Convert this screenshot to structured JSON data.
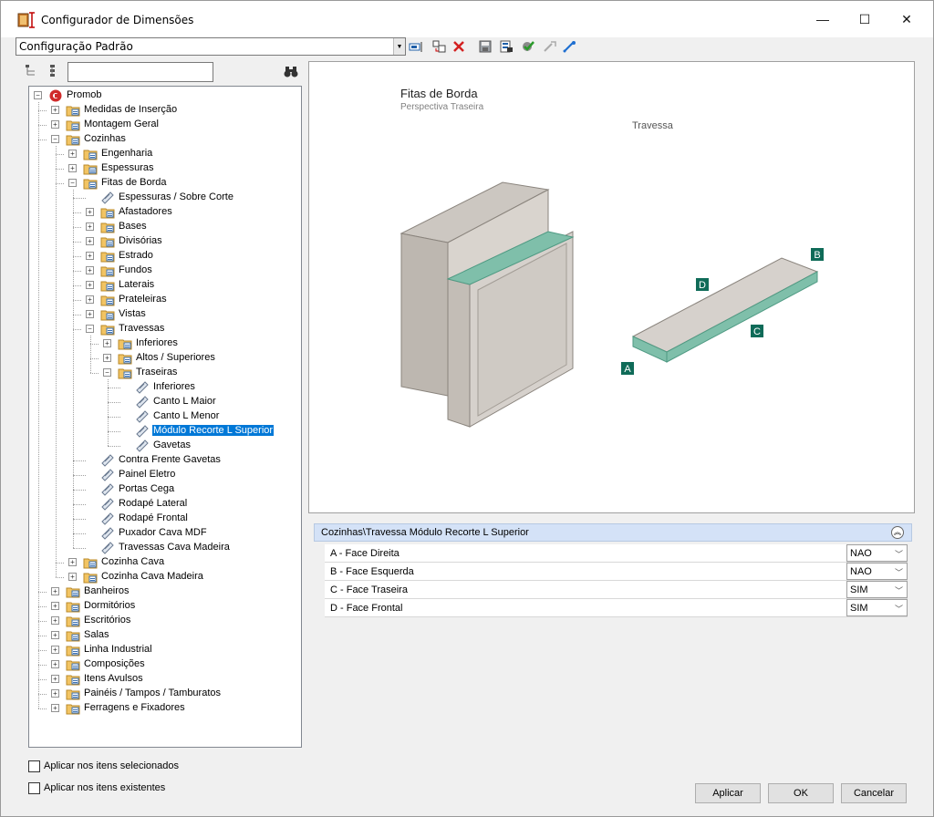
{
  "window": {
    "title": "Configurador de Dimensões",
    "minimize_glyph": "—",
    "maximize_glyph": "☐",
    "close_glyph": "✕"
  },
  "toolbar": {
    "config_value": "Configuração Padrão",
    "buttons": [
      "rename-icon",
      "copy-icon",
      "delete-icon",
      "save-icon",
      "export-icon",
      "validate-icon",
      "pick-icon",
      "measure-icon"
    ]
  },
  "left": {
    "search_value": "",
    "tree": [
      {
        "label": "Promob",
        "level": 0,
        "exp": "-",
        "icon": "promob"
      },
      {
        "label": "Medidas de Inserção",
        "level": 1,
        "exp": "+",
        "icon": "folder"
      },
      {
        "label": "Montagem Geral",
        "level": 1,
        "exp": "+",
        "icon": "folder"
      },
      {
        "label": "Cozinhas",
        "level": 1,
        "exp": "-",
        "icon": "folder"
      },
      {
        "label": "Engenharia",
        "level": 2,
        "exp": "+",
        "icon": "folder"
      },
      {
        "label": "Espessuras",
        "level": 2,
        "exp": "+",
        "icon": "folder"
      },
      {
        "label": "Fitas de Borda",
        "level": 2,
        "exp": "-",
        "icon": "folder"
      },
      {
        "label": "Espessuras / Sobre Corte",
        "level": 3,
        "exp": "",
        "icon": "item"
      },
      {
        "label": "Afastadores",
        "level": 3,
        "exp": "+",
        "icon": "folder"
      },
      {
        "label": "Bases",
        "level": 3,
        "exp": "+",
        "icon": "folder"
      },
      {
        "label": "Divisórias",
        "level": 3,
        "exp": "+",
        "icon": "folder"
      },
      {
        "label": "Estrado",
        "level": 3,
        "exp": "+",
        "icon": "folder"
      },
      {
        "label": "Fundos",
        "level": 3,
        "exp": "+",
        "icon": "folder"
      },
      {
        "label": "Laterais",
        "level": 3,
        "exp": "+",
        "icon": "folder"
      },
      {
        "label": "Prateleiras",
        "level": 3,
        "exp": "+",
        "icon": "folder"
      },
      {
        "label": "Vistas",
        "level": 3,
        "exp": "+",
        "icon": "folder"
      },
      {
        "label": "Travessas",
        "level": 3,
        "exp": "-",
        "icon": "folder"
      },
      {
        "label": "Inferiores",
        "level": 4,
        "exp": "+",
        "icon": "folder"
      },
      {
        "label": "Altos / Superiores",
        "level": 4,
        "exp": "+",
        "icon": "folder"
      },
      {
        "label": "Traseiras",
        "level": 4,
        "exp": "-",
        "icon": "folder"
      },
      {
        "label": "Inferiores",
        "level": 5,
        "exp": "",
        "icon": "item"
      },
      {
        "label": "Canto L Maior",
        "level": 5,
        "exp": "",
        "icon": "item"
      },
      {
        "label": "Canto L Menor",
        "level": 5,
        "exp": "",
        "icon": "item"
      },
      {
        "label": "Módulo Recorte L Superior",
        "level": 5,
        "exp": "",
        "icon": "item",
        "selected": true
      },
      {
        "label": "Gavetas",
        "level": 5,
        "exp": "",
        "icon": "item"
      },
      {
        "label": "Contra Frente Gavetas",
        "level": 3,
        "exp": "",
        "icon": "item"
      },
      {
        "label": "Painel Eletro",
        "level": 3,
        "exp": "",
        "icon": "item"
      },
      {
        "label": "Portas Cega",
        "level": 3,
        "exp": "",
        "icon": "item"
      },
      {
        "label": "Rodapé Lateral",
        "level": 3,
        "exp": "",
        "icon": "item"
      },
      {
        "label": "Rodapé Frontal",
        "level": 3,
        "exp": "",
        "icon": "item"
      },
      {
        "label": "Puxador Cava MDF",
        "level": 3,
        "exp": "",
        "icon": "item"
      },
      {
        "label": "Travessas Cava Madeira",
        "level": 3,
        "exp": "",
        "icon": "item"
      },
      {
        "label": "Cozinha Cava",
        "level": 2,
        "exp": "+",
        "icon": "folder"
      },
      {
        "label": "Cozinha Cava Madeira",
        "level": 2,
        "exp": "+",
        "icon": "folder"
      },
      {
        "label": "Banheiros",
        "level": 1,
        "exp": "+",
        "icon": "folder"
      },
      {
        "label": "Dormitórios",
        "level": 1,
        "exp": "+",
        "icon": "folder"
      },
      {
        "label": "Escritórios",
        "level": 1,
        "exp": "+",
        "icon": "folder"
      },
      {
        "label": "Salas",
        "level": 1,
        "exp": "+",
        "icon": "folder"
      },
      {
        "label": "Linha Industrial",
        "level": 1,
        "exp": "+",
        "icon": "folder"
      },
      {
        "label": "Composições",
        "level": 1,
        "exp": "+",
        "icon": "folder"
      },
      {
        "label": "Itens Avulsos",
        "level": 1,
        "exp": "+",
        "icon": "folder"
      },
      {
        "label": "Painéis / Tampos / Tamburatos",
        "level": 1,
        "exp": "+",
        "icon": "folder"
      },
      {
        "label": "Ferragens e Fixadores",
        "level": 1,
        "exp": "+",
        "icon": "folder"
      }
    ]
  },
  "preview": {
    "title": "Fitas de Borda",
    "subtitle": "Perspectiva Traseira",
    "caption": "Travessa",
    "markers": [
      "A",
      "B",
      "C",
      "D"
    ],
    "colors": {
      "cabinet": "#d6d1cc",
      "edge_band": "#7fbfaa",
      "marker": "#0f6b58"
    }
  },
  "properties": {
    "header": "Cozinhas\\Travessa Módulo Recorte L Superior",
    "collapse_glyph": "︽",
    "rows": [
      {
        "name": "A - Face Direita",
        "value": "NAO"
      },
      {
        "name": "B - Face Esquerda",
        "value": "NAO"
      },
      {
        "name": "C - Face Traseira",
        "value": "SIM"
      },
      {
        "name": "D - Face Frontal",
        "value": "SIM"
      }
    ]
  },
  "footer": {
    "check_selected": "Aplicar nos itens selecionados",
    "check_existing": "Aplicar nos itens existentes",
    "apply": "Aplicar",
    "ok": "OK",
    "cancel": "Cancelar"
  }
}
